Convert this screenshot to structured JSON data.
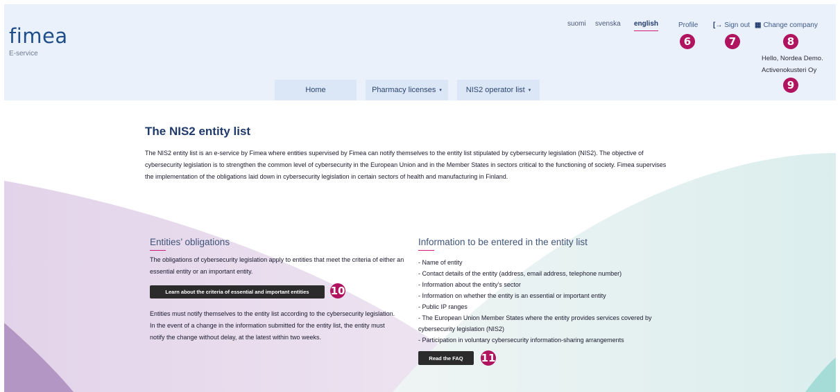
{
  "header": {
    "logo": "fimea",
    "logo_sub": "E-service",
    "languages": [
      "suomi",
      "svenska",
      "english"
    ],
    "profile": "Profile",
    "sign_out": "Sign out",
    "change_company": "Change company",
    "hello_line1": "Hello, Nordea Demo.",
    "hello_line2": "Activenokusteri Oy",
    "icons": {
      "sign_out": "sign-out-icon",
      "change_company": "building-icon"
    }
  },
  "badges": [
    "6",
    "7",
    "8",
    "9",
    "10",
    "11"
  ],
  "nav": {
    "home": "Home",
    "pharmacy": "Pharmacy licenses",
    "nis2": "NIS2 operator list",
    "caret": "▾"
  },
  "main": {
    "title": "The NIS2 entity list",
    "intro": "The NIS2 entity list is an e-service by Fimea where entities supervised by Fimea can notify themselves to the entity list stipulated by cybersecurity legislation (NIS2). The objective of cybersecurity legislation is to strengthen the common level of cybersecurity in the European Union and in the Member States in sectors critical to the functioning of society. Fimea supervises the implementation of the obligations laid down in cybersecurity legislation in certain sectors of health and manufacturing in Finland.",
    "obligations": {
      "heading": "Entities’ obligations",
      "text1": "The obligations of cybersecurity legislation apply to entities that meet the criteria of either an essential entity or an important entity.",
      "button": "Learn about the criteria of essential and important entities",
      "text2": "Entities must notify themselves to the entity list according to the cybersecurity legislation. In the event of a change in the information submitted for the entity list, the entity must notify the change without delay, at the latest within two weeks."
    },
    "info": {
      "heading": "Information to be entered in the entity list",
      "items": [
        "- Name of entity",
        "- Contact details of the entity (address, email address, telephone number)",
        "- Information about the entity’s sector",
        "- Information on whether the entity is an essential or important entity",
        "- Public IP ranges",
        "- The European Union Member States where the entity provides services covered by cybersecurity legislation (NIS2)",
        "- Participation in voluntary cybersecurity information-sharing arrangements"
      ],
      "button": "Read the FAQ"
    }
  },
  "colors": {
    "accent": "#d0197a",
    "badge": "#b0145f",
    "header_bg": "#eaf1fb",
    "title": "#1f3a6b"
  }
}
